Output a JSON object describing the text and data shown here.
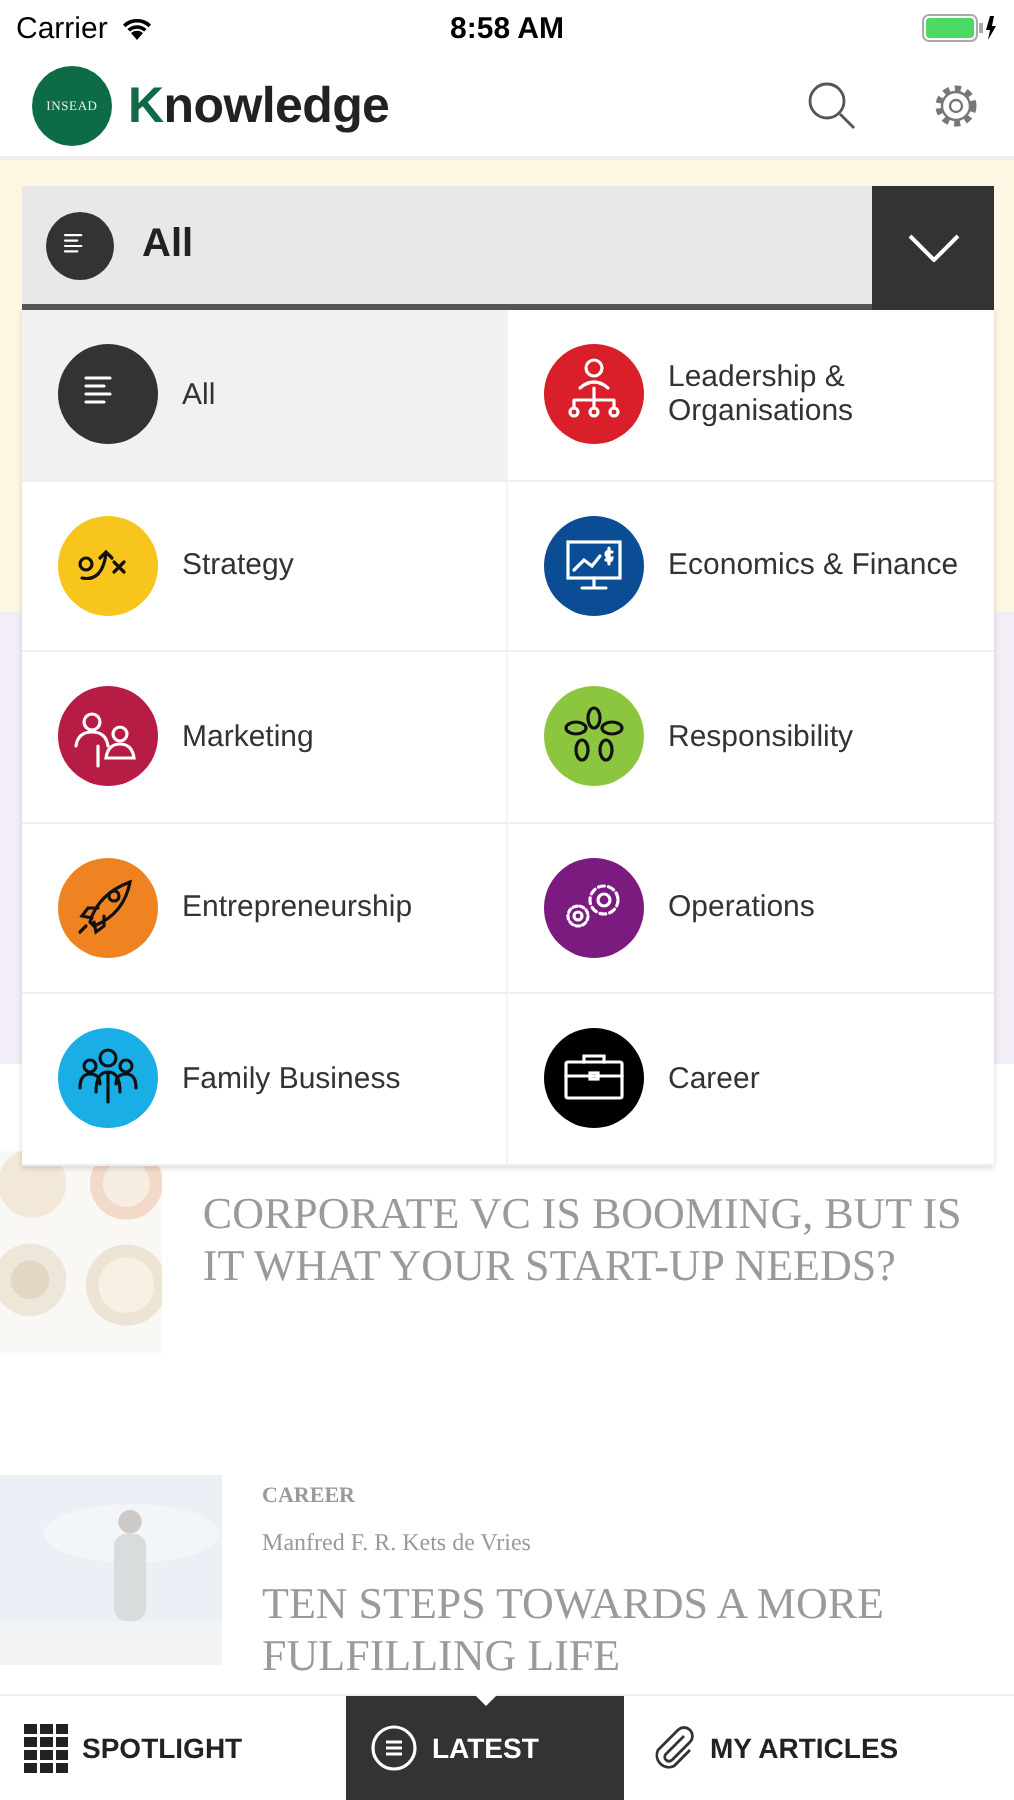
{
  "status_bar": {
    "carrier": "Carrier",
    "time": "8:58 AM"
  },
  "header": {
    "logo_text": "INSEAD",
    "title": "Knowledge"
  },
  "category_select": {
    "value": "All",
    "expanded": true
  },
  "categories": [
    {
      "label": "All",
      "kind": "lines",
      "color": "#333333",
      "selected": true
    },
    {
      "label": "Leadership & Organisations",
      "kind": "hierarchy",
      "color": "#d81f2a",
      "selected": false
    },
    {
      "label": "Strategy",
      "kind": "play",
      "color": "#f7c51c",
      "selected": false
    },
    {
      "label": "Economics & Finance",
      "kind": "monitor",
      "color": "#0a4d94",
      "selected": false
    },
    {
      "label": "Marketing",
      "kind": "people",
      "color": "#b71c45",
      "selected": false
    },
    {
      "label": "Responsibility",
      "kind": "flower",
      "color": "#8cc63f",
      "selected": false
    },
    {
      "label": "Entrepreneurship",
      "kind": "rocket",
      "color": "#f08321",
      "selected": false
    },
    {
      "label": "Operations",
      "kind": "gears",
      "color": "#7b1a7f",
      "selected": false
    },
    {
      "label": "Family Business",
      "kind": "family",
      "color": "#1aaee6",
      "selected": false
    },
    {
      "label": "Career",
      "kind": "briefcase",
      "color": "#000000",
      "selected": false
    }
  ],
  "articles": [
    {
      "title": "CORPORATE VC IS BOOMING, BUT IS IT WHAT YOUR START-UP NEEDS?"
    },
    {
      "category": "CAREER",
      "author": "Manfred F. R. Kets de Vries",
      "title": "TEN STEPS TOWARDS A MORE FULFILLING LIFE"
    }
  ],
  "tabs": [
    {
      "label": "SPOTLIGHT",
      "kind": "grid",
      "selected": false
    },
    {
      "label": "LATEST",
      "kind": "list",
      "selected": true
    },
    {
      "label": "MY ARTICLES",
      "kind": "clip",
      "selected": false
    }
  ]
}
